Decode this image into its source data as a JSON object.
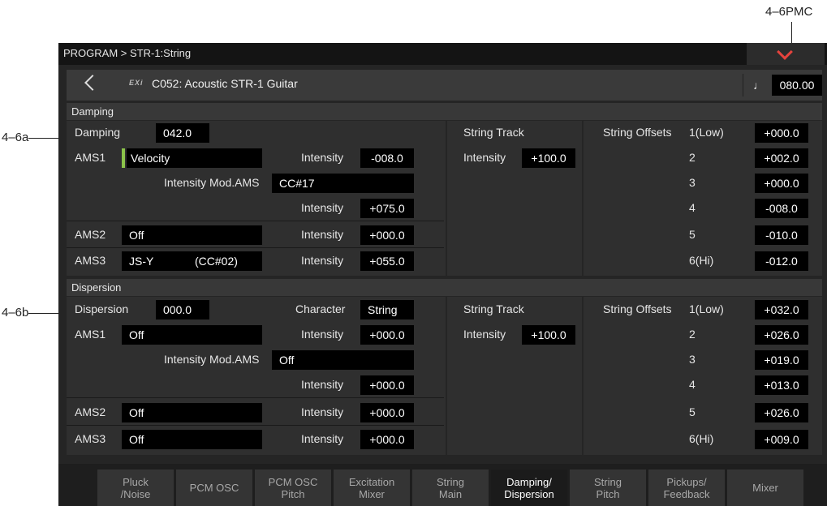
{
  "annotations": {
    "pmc": "4–6PMC",
    "damping": "4–6a",
    "dispersion": "4–6b"
  },
  "breadcrumb": "PROGRAM > STR-1:String",
  "header": {
    "badge": "EXi",
    "program_name": "C052: Acoustic STR-1 Guitar",
    "tempo_symbol": "♩",
    "tempo": "080.00"
  },
  "damping": {
    "section_label": "Damping",
    "main_label": "Damping",
    "main_value": "042.0",
    "ams1": {
      "label": "AMS1",
      "source": "Velocity",
      "intensity_label": "Intensity",
      "intensity": "-008.0"
    },
    "mod": {
      "label": "Intensity Mod.AMS",
      "value": "CC#17",
      "intensity_label": "Intensity",
      "intensity": "+075.0"
    },
    "ams2": {
      "label": "AMS2",
      "source": "Off",
      "intensity_label": "Intensity",
      "intensity": "+000.0"
    },
    "ams3": {
      "label": "AMS3",
      "source": "JS-Y",
      "source_cc": "(CC#02)",
      "intensity_label": "Intensity",
      "intensity": "+055.0"
    },
    "string_track": {
      "title": "String Track",
      "intensity_label": "Intensity",
      "intensity": "+100.0"
    },
    "offsets": {
      "title": "String Offsets",
      "strings": [
        {
          "label": "1(Low)",
          "value": "+000.0"
        },
        {
          "label": "2",
          "value": "+002.0"
        },
        {
          "label": "3",
          "value": "+000.0"
        },
        {
          "label": "4",
          "value": "-008.0"
        },
        {
          "label": "5",
          "value": "-010.0"
        },
        {
          "label": "6(Hi)",
          "value": "-012.0"
        }
      ]
    }
  },
  "dispersion": {
    "section_label": "Dispersion",
    "main_label": "Dispersion",
    "main_value": "000.0",
    "character_label": "Character",
    "character_value": "String",
    "ams1": {
      "label": "AMS1",
      "source": "Off",
      "intensity_label": "Intensity",
      "intensity": "+000.0"
    },
    "mod": {
      "label": "Intensity Mod.AMS",
      "value": "Off",
      "intensity_label": "Intensity",
      "intensity": "+000.0"
    },
    "ams2": {
      "label": "AMS2",
      "source": "Off",
      "intensity_label": "Intensity",
      "intensity": "+000.0"
    },
    "ams3": {
      "label": "AMS3",
      "source": "Off",
      "intensity_label": "Intensity",
      "intensity": "+000.0"
    },
    "string_track": {
      "title": "String Track",
      "intensity_label": "Intensity",
      "intensity": "+100.0"
    },
    "offsets": {
      "title": "String Offsets",
      "strings": [
        {
          "label": "1(Low)",
          "value": "+032.0"
        },
        {
          "label": "2",
          "value": "+026.0"
        },
        {
          "label": "3",
          "value": "+019.0"
        },
        {
          "label": "4",
          "value": "+013.0"
        },
        {
          "label": "5",
          "value": "+026.0"
        },
        {
          "label": "6(Hi)",
          "value": "+009.0"
        }
      ]
    }
  },
  "tabs": [
    {
      "line1": "Pluck",
      "line2": "/Noise"
    },
    {
      "line1": "PCM OSC",
      "line2": ""
    },
    {
      "line1": "PCM OSC",
      "line2": "Pitch"
    },
    {
      "line1": "Excitation",
      "line2": "Mixer"
    },
    {
      "line1": "String",
      "line2": "Main"
    },
    {
      "line1": "Damping/",
      "line2": "Dispersion"
    },
    {
      "line1": "String",
      "line2": "Pitch"
    },
    {
      "line1": "Pickups/",
      "line2": "Feedback"
    },
    {
      "line1": "Mixer",
      "line2": ""
    }
  ],
  "active_tab": "Damping/ Dispersion",
  "colors": {
    "accent": "#e5433d",
    "ams_indicator": "#8bc34a",
    "value_box": "#000000"
  }
}
